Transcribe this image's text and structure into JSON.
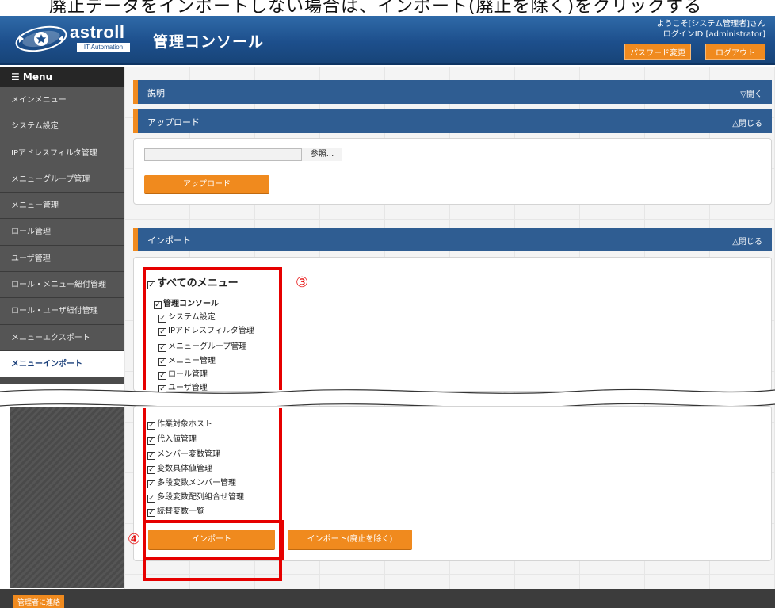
{
  "caption": "廃止データをインポートしない場合は、インポート(廃止を除く)をクリックする",
  "header": {
    "logo_name": "astroll",
    "logo_sub": "IT Automation",
    "app_title": "管理コンソール",
    "welcome": "ようこそ[システム管理者]さん",
    "login_id": "ログインID [administrator]",
    "password_button": "パスワード変更",
    "logout_button": "ログアウト"
  },
  "sidebar": {
    "menu_label": "☰ Menu",
    "items": [
      {
        "label": "メインメニュー"
      },
      {
        "label": "システム設定"
      },
      {
        "label": "IPアドレスフィルタ管理"
      },
      {
        "label": "メニューグループ管理"
      },
      {
        "label": "メニュー管理"
      },
      {
        "label": "ロール管理"
      },
      {
        "label": "ユーザ管理"
      },
      {
        "label": "ロール・メニュー紐付管理"
      },
      {
        "label": "ロール・ユーザ紐付管理"
      },
      {
        "label": "メニューエクスポート"
      },
      {
        "label": "メニューインポート",
        "active": true
      }
    ]
  },
  "sections": {
    "description": {
      "title": "説明",
      "toggle": "▽開く"
    },
    "upload": {
      "title": "アップロード",
      "toggle": "△閉じる",
      "browse_button": "参照...",
      "upload_button": "アップロード"
    },
    "import": {
      "title": "インポート",
      "toggle": "△閉じる"
    }
  },
  "tree": {
    "root": "すべてのメニュー",
    "group": "管理コンソール",
    "items_top": [
      "システム設定",
      "IPアドレスフィルタ管理",
      "メニューグループ管理",
      "メニュー管理",
      "ロール管理",
      "ユーザ管理"
    ],
    "items_bottom": [
      "作業対象ホスト",
      "代入値管理",
      "メンバー変数管理",
      "変数具体値管理",
      "多段変数メンバー管理",
      "多段変数配列組合せ管理",
      "読替変数一覧"
    ]
  },
  "buttons": {
    "import": "インポート",
    "import_excluding": "インポート(廃止を除く)"
  },
  "annotations": {
    "step3": "③",
    "step4": "④"
  },
  "footer": {
    "contact_button": "管理者に連絡"
  }
}
